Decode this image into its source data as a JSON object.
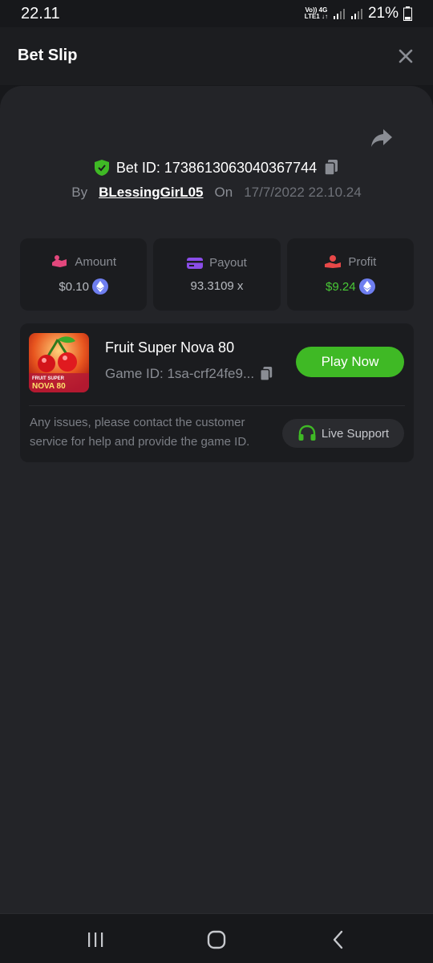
{
  "status_bar": {
    "time": "22.11",
    "network_top": "Vo)) 4G",
    "network_bottom": "LTE1 ↓↑",
    "battery": "21%",
    "icons": [
      "signal-icon",
      "signal-icon",
      "battery-icon"
    ]
  },
  "header": {
    "title": "Bet Slip",
    "close_icon": "close-icon"
  },
  "bet": {
    "share_icon": "share-icon",
    "id_label": "Bet ID: 1738613063040367744",
    "by_label": "By",
    "username": "BLessingGirL05",
    "on_label": "On",
    "date": "17/7/2022 22.10.24"
  },
  "stats": [
    {
      "label": "Amount",
      "value": "$0.10",
      "icon": "amount-icon",
      "currency_icon": "eth-icon"
    },
    {
      "label": "Payout",
      "value": "93.3109 x",
      "icon": "card-icon"
    },
    {
      "label": "Profit",
      "value": "$9.24",
      "icon": "profit-icon",
      "currency_icon": "eth-icon"
    }
  ],
  "game": {
    "title": "Fruit Super Nova 80",
    "id_label": "Game ID: 1sa-crf24fe9...",
    "thumb_text_top": "FRUIT SUPER",
    "thumb_text_bottom": "NOVA 80",
    "play_label": "Play Now",
    "notice": "Any issues, please contact the customer service for help and provide the game ID.",
    "support_label": "Live Support"
  },
  "colors": {
    "accent_green": "#3fb925",
    "profit_green": "#49c936",
    "eth_blue": "#6e7ef0",
    "amount_pink": "#e2477c",
    "payout_purple": "#8a4de8",
    "profit_red": "#e84848"
  },
  "nav": [
    "recents-icon",
    "home-icon",
    "back-icon"
  ]
}
